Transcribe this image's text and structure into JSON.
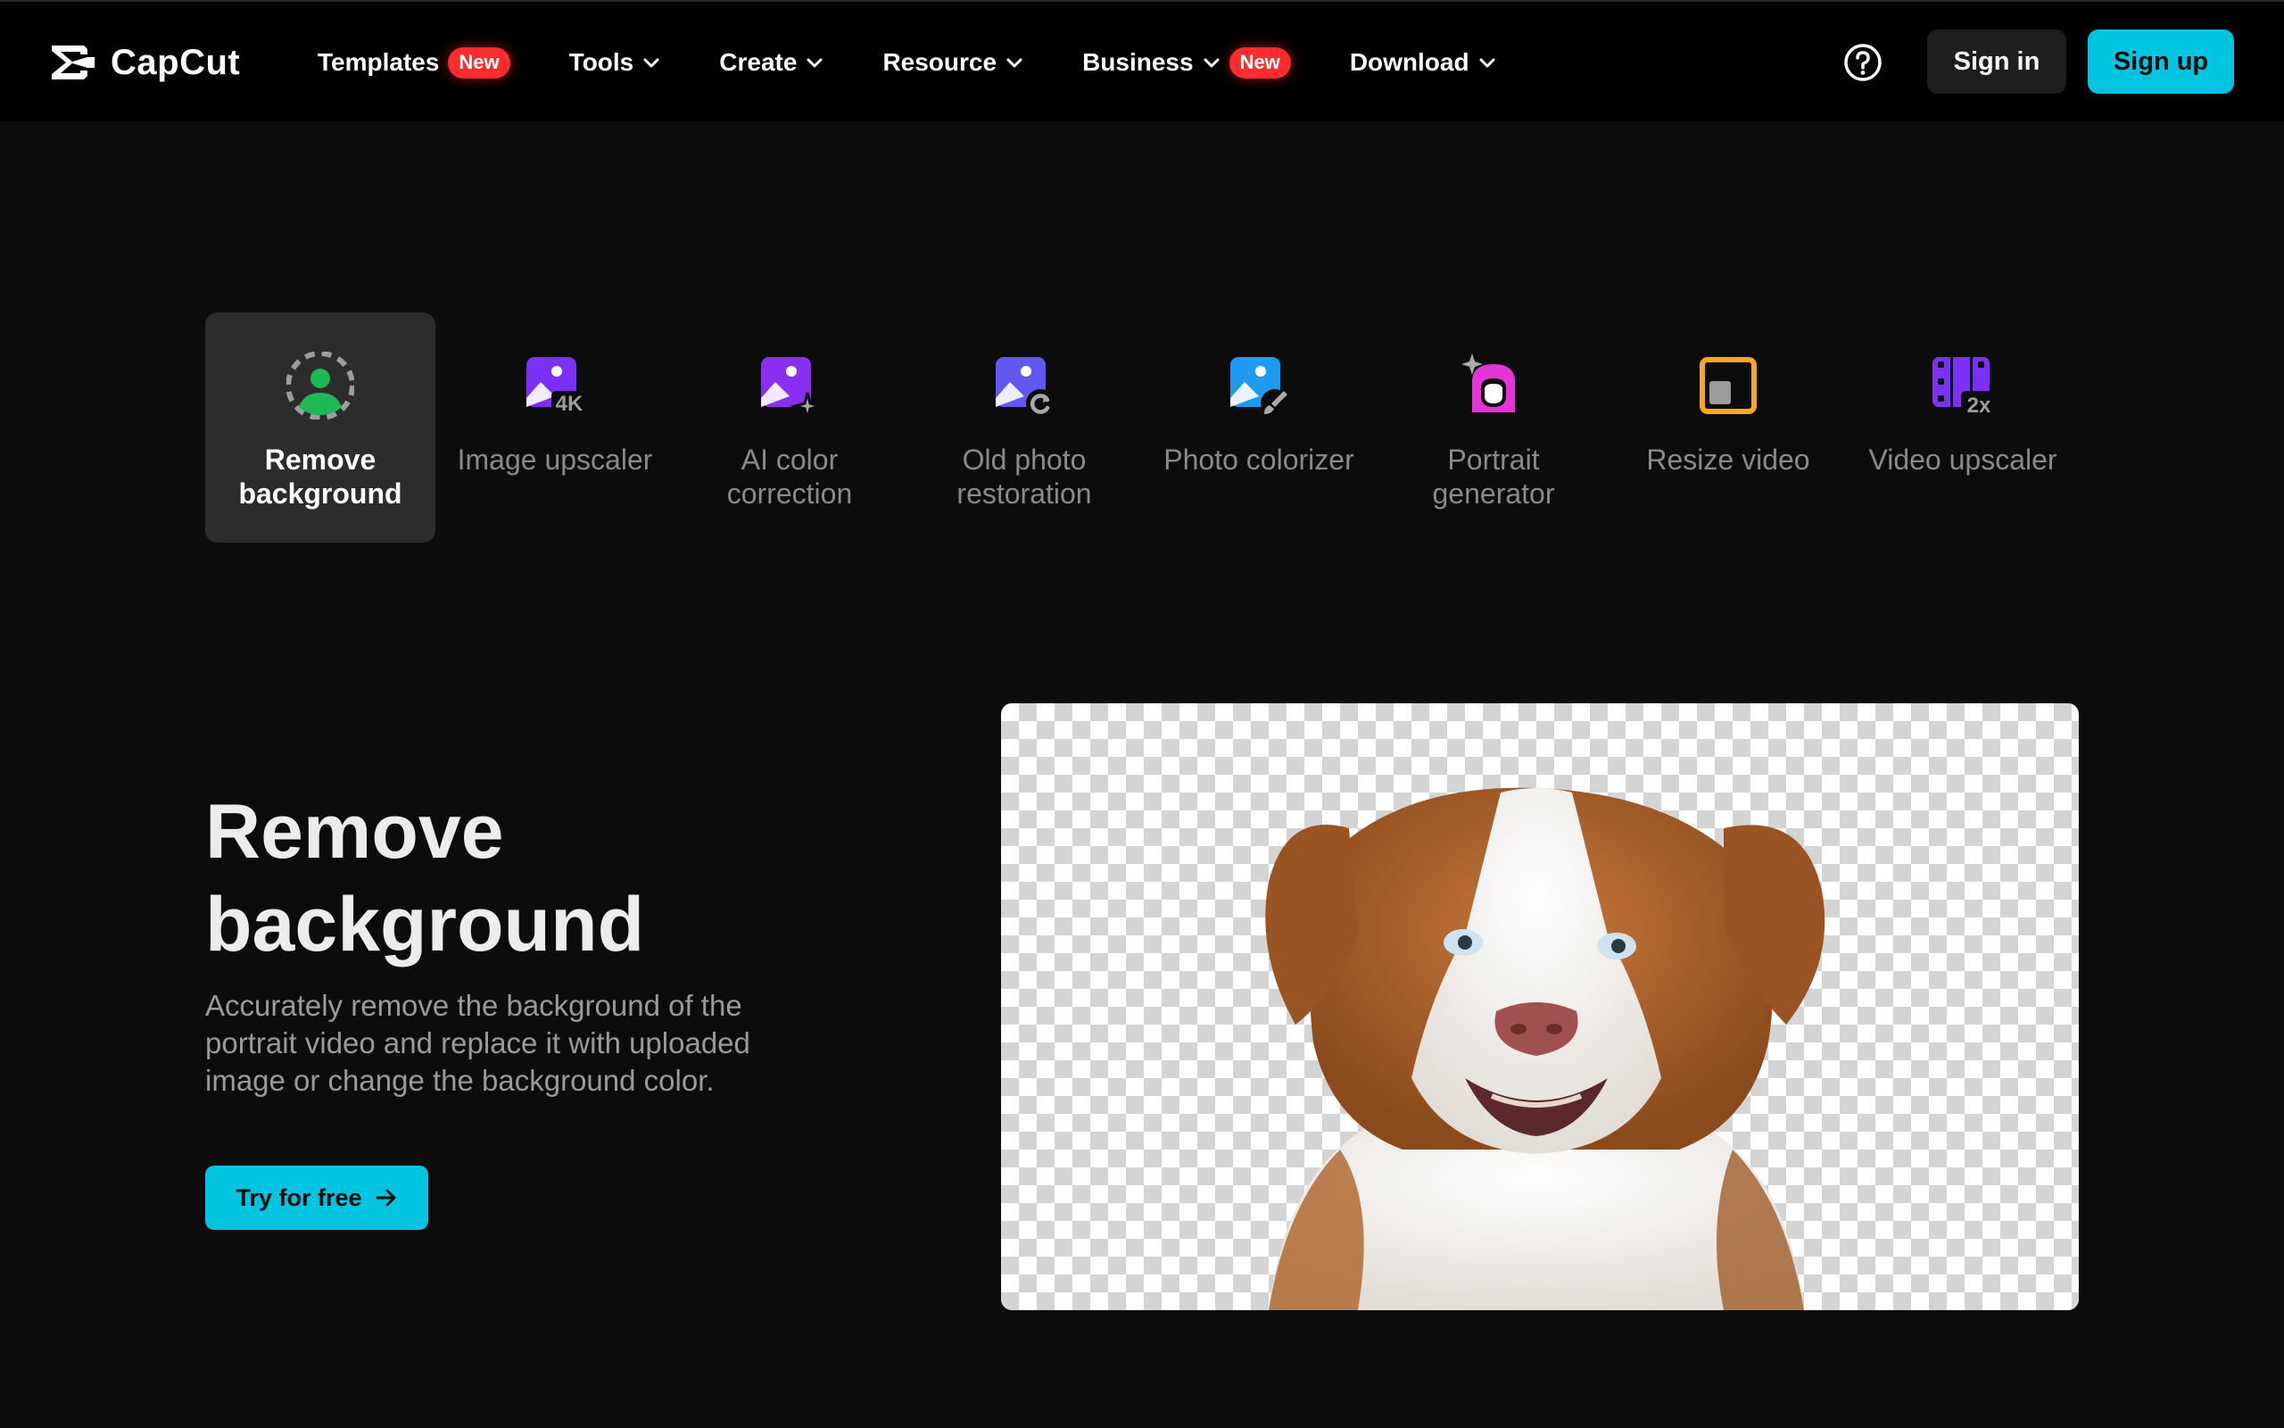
{
  "header": {
    "brand": "CapCut",
    "nav": [
      {
        "label": "Templates",
        "badge": "New",
        "chevron": false
      },
      {
        "label": "Tools",
        "badge": "",
        "chevron": true
      },
      {
        "label": "Create",
        "badge": "",
        "chevron": true
      },
      {
        "label": "Resource",
        "badge": "",
        "chevron": true
      },
      {
        "label": "Business",
        "badge": "New",
        "chevron": true
      },
      {
        "label": "Download",
        "badge": "",
        "chevron": true
      }
    ],
    "sign_in": "Sign in",
    "sign_up": "Sign up"
  },
  "tools": [
    {
      "label": "Remove background",
      "icon": "remove-background-icon",
      "active": true
    },
    {
      "label": "Image upscaler",
      "icon": "image-upscaler-icon",
      "active": false
    },
    {
      "label": "AI color correction",
      "icon": "ai-color-correction-icon",
      "active": false
    },
    {
      "label": "Old photo restoration",
      "icon": "old-photo-restoration-icon",
      "active": false
    },
    {
      "label": "Photo colorizer",
      "icon": "photo-colorizer-icon",
      "active": false
    },
    {
      "label": "Portrait generator",
      "icon": "portrait-generator-icon",
      "active": false
    },
    {
      "label": "Resize video",
      "icon": "resize-video-icon",
      "active": false
    },
    {
      "label": "Video upscaler",
      "icon": "video-upscaler-icon",
      "active": false
    }
  ],
  "hero": {
    "title": "Remove background",
    "description": "Accurately remove the background of the portrait video and replace it with uploaded image or change the background color.",
    "cta": "Try for free"
  },
  "colors": {
    "accent": "#00c4e0",
    "badge": "#fe2c2c",
    "background": "#0c0c0c",
    "header": "#000000"
  }
}
